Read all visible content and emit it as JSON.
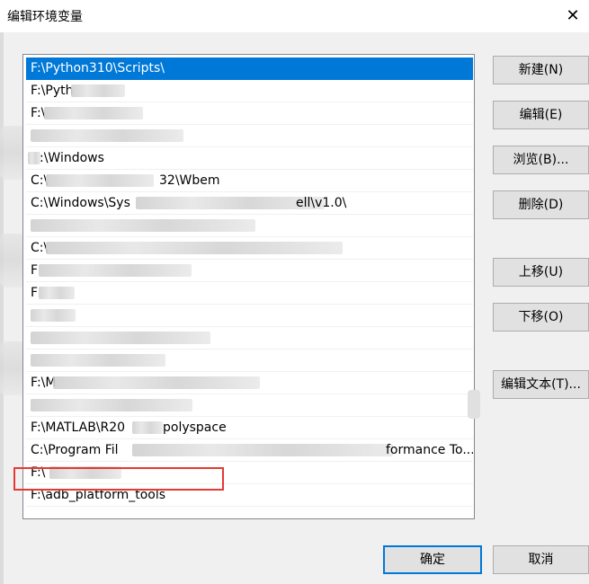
{
  "window": {
    "title": "编辑环境变量",
    "close_glyph": "✕"
  },
  "list": {
    "rows": [
      "F:\\Python310\\Scripts\\",
      "F:\\Pyth",
      "F:\\",
      "",
      ":\\Windows",
      "C:\\",
      "C:\\Windows\\Sys",
      "",
      "C:\\",
      "F",
      "F",
      "",
      "",
      "",
      "F:\\M",
      "",
      "F:\\MATLAB\\R20",
      "C:\\Program Fil",
      "F:\\",
      "F:\\adb_platform_tools",
      ""
    ],
    "partial": {
      "row5_tail": "32\\Wbem",
      "row6_tail": "ell\\v1.0\\",
      "row16_tail": "polyspace",
      "row17_tail": "formance To..."
    }
  },
  "buttons": {
    "new": "新建(N)",
    "edit": "编辑(E)",
    "browse": "浏览(B)...",
    "delete": "删除(D)",
    "move_up": "上移(U)",
    "move_down": "下移(O)",
    "edit_text": "编辑文本(T)...",
    "ok": "确定",
    "cancel": "取消"
  },
  "colors": {
    "selection": "#0078d7",
    "highlight_box": "#e53935"
  }
}
